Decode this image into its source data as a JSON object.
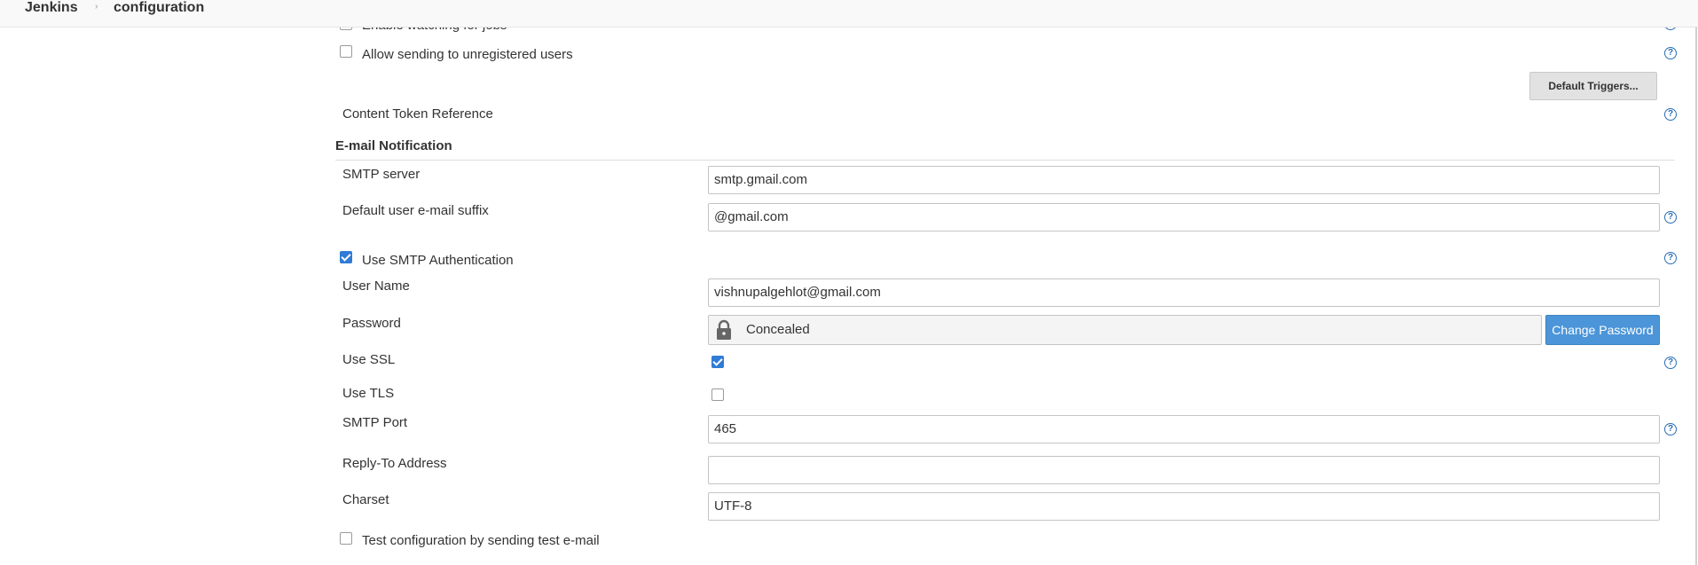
{
  "breadcrumb": {
    "root": "Jenkins",
    "separator": "›",
    "current": "configuration"
  },
  "extended_email": {
    "enable_watching_label": "Enable watching for jobs",
    "allow_unregistered_label": "Allow sending to unregistered users",
    "allow_unregistered_checked": false,
    "default_triggers_button": "Default Triggers...",
    "content_token_label": "Content Token Reference"
  },
  "email_notification": {
    "section_title": "E-mail Notification",
    "smtp_server_label": "SMTP server",
    "smtp_server_value": "smtp.gmail.com",
    "default_suffix_label": "Default user e-mail suffix",
    "default_suffix_value": "@gmail.com",
    "use_smtp_auth_label": "Use SMTP Authentication",
    "use_smtp_auth_checked": true,
    "username_label": "User Name",
    "username_value": "vishnupalgehlot@gmail.com",
    "password_label": "Password",
    "password_value": "Concealed",
    "change_password_button": "Change Password",
    "use_ssl_label": "Use SSL",
    "use_ssl_checked": true,
    "use_tls_label": "Use TLS",
    "use_tls_checked": false,
    "smtp_port_label": "SMTP Port",
    "smtp_port_value": "465",
    "reply_to_label": "Reply-To Address",
    "reply_to_value": "",
    "charset_label": "Charset",
    "charset_value": "UTF-8",
    "test_config_label": "Test configuration by sending test e-mail",
    "test_config_checked": false
  },
  "colors": {
    "accent": "#2f7bd6",
    "primary_button": "#4b95d8",
    "help_icon": "#2a6db5"
  },
  "icons": {
    "help": "help-icon",
    "lock": "lock-icon",
    "separator": "chevron-right-icon"
  }
}
